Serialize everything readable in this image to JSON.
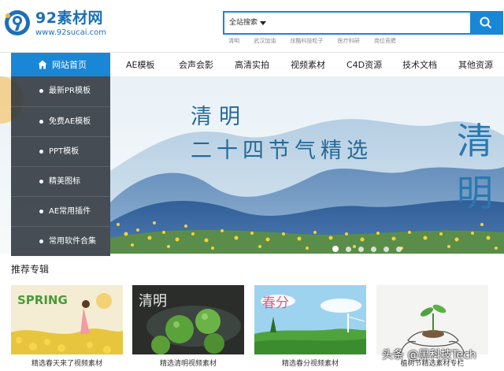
{
  "logo": {
    "title": "92素材网",
    "url": "www.92sucai.com",
    "icon": "logo-icon"
  },
  "search": {
    "scope": "全站搜索",
    "placeholder": "",
    "button_icon": "search-icon"
  },
  "hot_keywords": [
    "清明",
    "武汉加油",
    "炫酷科技粒子",
    "医疗科研",
    "岗位竞聘"
  ],
  "nav": {
    "home": "网站首页",
    "home_icon": "home-icon",
    "items": [
      "AE模板",
      "会声会影",
      "高清实拍",
      "视频素材",
      "C4D资源",
      "技术文档",
      "其他资源"
    ]
  },
  "sidebar": {
    "items": [
      "最新PR模板",
      "免费AE模板",
      "PPT模板",
      "精美图标",
      "AE常用插件",
      "常用软件合集"
    ]
  },
  "banner": {
    "title": "清明",
    "subtitle": "二十四节气精选",
    "calligraphy": "清明",
    "active_slide": 1,
    "slide_count": 6
  },
  "recommended": {
    "title": "推荐专辑",
    "cards": [
      {
        "caption": "精选春天来了视频素材",
        "image_text": "SPRING"
      },
      {
        "caption": "精选清明视频素材",
        "image_text": "清明"
      },
      {
        "caption": "精选春分视频素材",
        "image_text": "春分"
      },
      {
        "caption": "植树节精选素材专栏",
        "image_text": ""
      }
    ]
  },
  "watermark": "头条 @黑科技Tech",
  "colors": {
    "brand_blue": "#1a86d6",
    "sidebar_bg": "#2d343c",
    "banner_text": "#26699a"
  }
}
